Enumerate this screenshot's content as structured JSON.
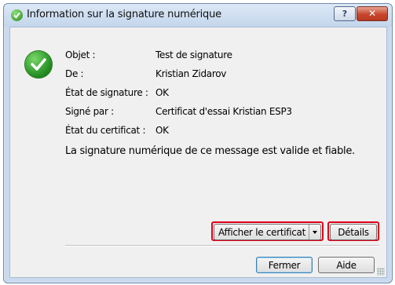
{
  "window": {
    "title": "Information sur la signature numérique",
    "help_glyph": "?",
    "close_glyph": "✕"
  },
  "fields": [
    {
      "label": "Objet :",
      "value": "Test de signature"
    },
    {
      "label": "De :",
      "value": "Kristian Zidarov"
    },
    {
      "label": "État de signature :",
      "value": "OK"
    },
    {
      "label": "Signé par :",
      "value": "Certificat d'essai Kristian ESP3"
    },
    {
      "label": "État du certificat :",
      "value": "OK"
    }
  ],
  "summary": "La signature numérique de ce message est valide et fiable.",
  "buttons": {
    "view_certificate": "Afficher le certificat",
    "details": "Détails",
    "close": "Fermer",
    "help": "Aide"
  },
  "colors": {
    "highlight_box": "#e0001a",
    "status_icon": "#2e8b1f"
  },
  "icons": {
    "title": "check-circle-icon",
    "status": "check-circle-icon"
  }
}
